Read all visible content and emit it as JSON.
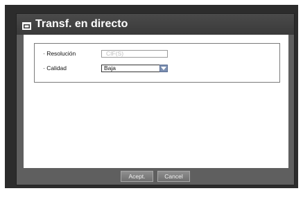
{
  "dialog": {
    "title": "Transf. en directo",
    "title_icon": "window-icon"
  },
  "settings": {
    "resolution": {
      "label": "· Resolución",
      "value": "CIF(S)"
    },
    "quality": {
      "label": "· Calidad",
      "value": "Baja"
    }
  },
  "buttons": {
    "accept": "Acept.",
    "cancel": "Cancel"
  }
}
